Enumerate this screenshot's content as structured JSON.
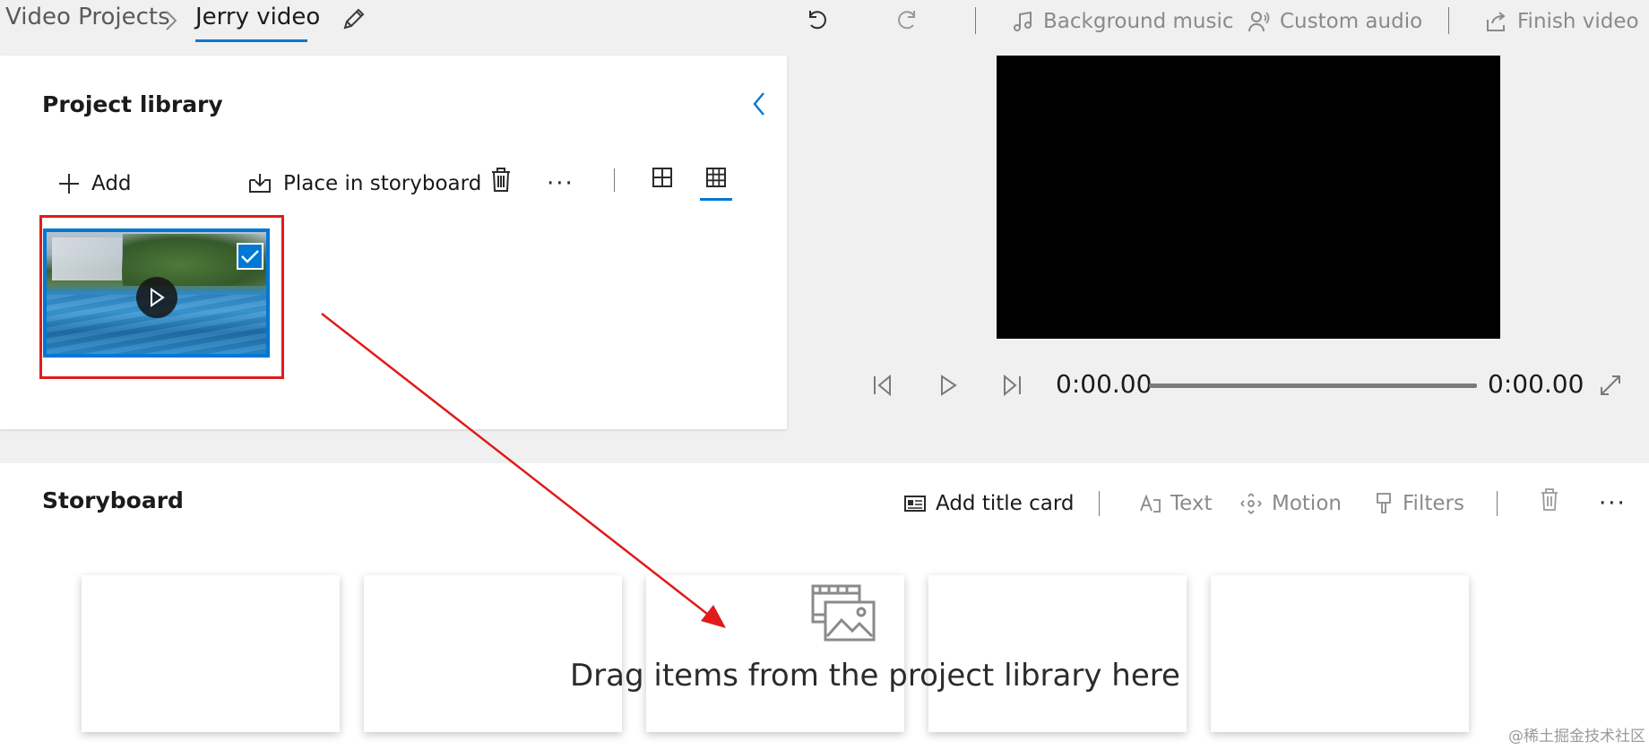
{
  "breadcrumb": {
    "parent": "Video Projects",
    "current": "Jerry video",
    "separator": ">"
  },
  "icons": {
    "edit": "pencil-icon",
    "undo": "undo-icon",
    "redo": "redo-icon",
    "music": "music-note-icon",
    "audio": "person-audio-icon",
    "finish": "share-export-icon"
  },
  "toolbar": {
    "background_music": "Background music",
    "custom_audio": "Custom audio",
    "finish_video": "Finish video"
  },
  "library": {
    "title": "Project library",
    "add_label": "Add",
    "place_label": "Place in storyboard",
    "more_label": "···",
    "active_view": "grid-small"
  },
  "player": {
    "current_time": "0:00.00",
    "total_time": "0:00.00",
    "progress": 0
  },
  "storyboard": {
    "title": "Storyboard",
    "add_title_card": "Add title card",
    "text_label": "Text",
    "motion_label": "Motion",
    "filters_label": "Filters",
    "more_label": "···",
    "empty_message": "Drag items from the project library here"
  },
  "watermark": "@稀土掘金技术社区",
  "colors": {
    "accent": "#0078d4",
    "highlight_red": "#e01b1b",
    "disabled_text": "#8a8a8a"
  }
}
